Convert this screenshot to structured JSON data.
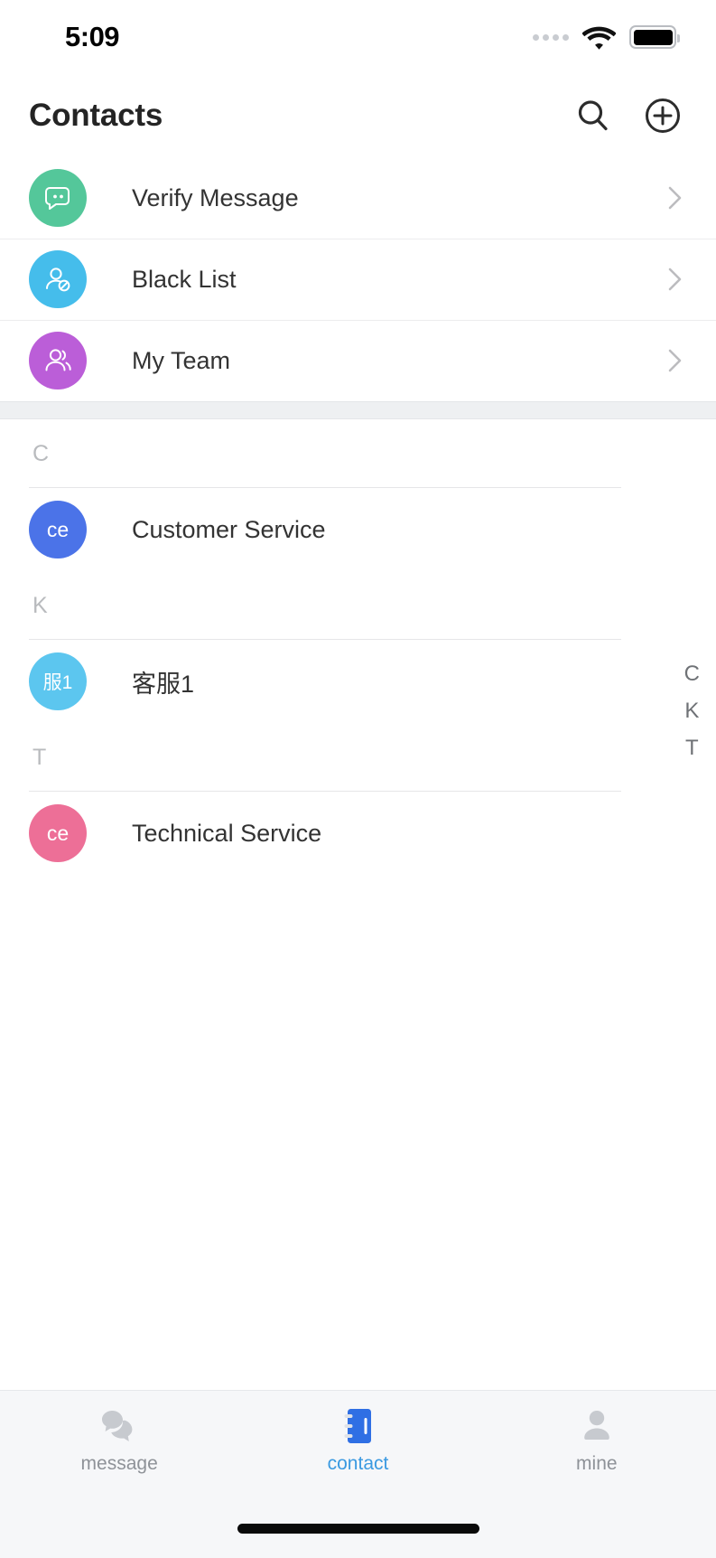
{
  "status_bar": {
    "time": "5:09",
    "signal_icon": "signal-dots-icon",
    "wifi_icon": "wifi-icon",
    "battery_icon": "battery-full-icon"
  },
  "header": {
    "title": "Contacts",
    "search_icon": "search-icon",
    "add_icon": "plus-circle-icon"
  },
  "entries": [
    {
      "label": "Verify Message",
      "icon": "chat-bubble-dots-icon",
      "color": "#54c79a",
      "chevron": "chevron-right-icon"
    },
    {
      "label": "Black List",
      "icon": "user-blocked-icon",
      "color": "#45bdeb",
      "chevron": "chevron-right-icon"
    },
    {
      "label": "My Team",
      "icon": "user-group-icon",
      "color": "#bb5ed8",
      "chevron": "chevron-right-icon"
    }
  ],
  "contact_sections": [
    {
      "letter": "C",
      "contacts": [
        {
          "name": "Customer Service",
          "initials": "ce",
          "color": "#4b73e8"
        }
      ]
    },
    {
      "letter": "K",
      "contacts": [
        {
          "name": "客服1",
          "initials": "服1",
          "color": "#5cc6ef"
        }
      ]
    },
    {
      "letter": "T",
      "contacts": [
        {
          "name": "Technical Service",
          "initials": "ce",
          "color": "#ed6f97"
        }
      ]
    }
  ],
  "index_bar": [
    "C",
    "K",
    "T"
  ],
  "tab_bar": {
    "tabs": [
      {
        "label": "message",
        "icon": "chat-bubbles-icon",
        "active": false,
        "color": "#c7cacf"
      },
      {
        "label": "contact",
        "icon": "address-book-icon",
        "active": true,
        "color": "#2f6fe4"
      },
      {
        "label": "mine",
        "icon": "person-icon",
        "active": false,
        "color": "#c7cacf"
      }
    ]
  },
  "colors": {
    "accent": "#3b9ae1",
    "active_tab": "#2f6fe4",
    "inactive_tab": "#8e9298",
    "divider": "#ececee",
    "band": "#eef0f2"
  }
}
